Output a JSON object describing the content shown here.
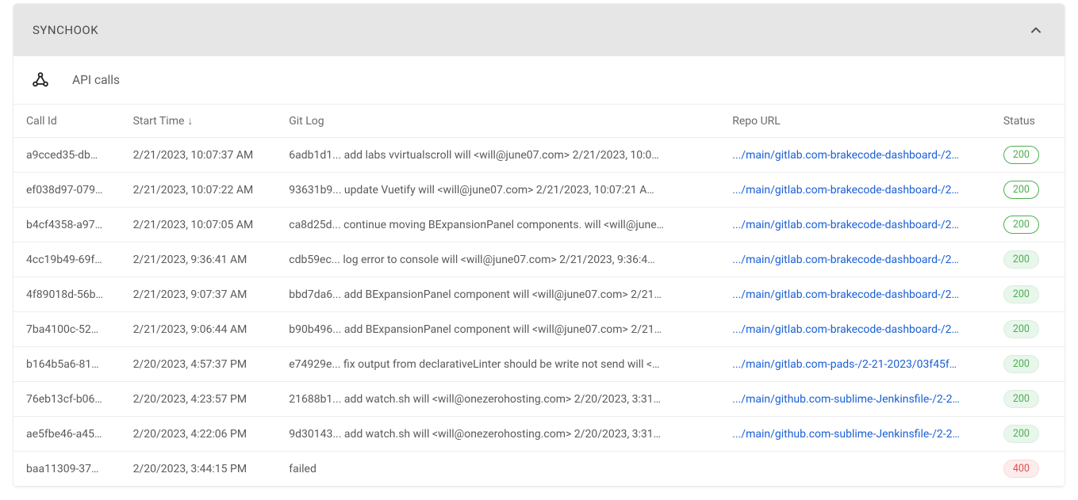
{
  "panel": {
    "title": "SYNCHOOK",
    "section_name": "API calls"
  },
  "table": {
    "headers": {
      "call_id": "Call Id",
      "start_time": "Start Time",
      "git_log": "Git Log",
      "repo_url": "Repo URL",
      "status": "Status"
    },
    "sort_indicator": "↓",
    "rows": [
      {
        "call_id": "a9cced35-db…",
        "start_time": "2/21/2023, 10:07:37 AM",
        "git_log": "6adb1d1...  add labs vvirtualscroll  will <will@june07.com>  2/21/2023, 10:0…",
        "repo_url": ".../main/gitlab.com-brakecode-dashboard-/2…",
        "status": "200",
        "status_style": "green-outline"
      },
      {
        "call_id": "ef038d97-079…",
        "start_time": "2/21/2023, 10:07:22 AM",
        "git_log": "93631b9...  update Vuetify  will <will@june07.com>  2/21/2023, 10:07:21 A…",
        "repo_url": ".../main/gitlab.com-brakecode-dashboard-/2…",
        "status": "200",
        "status_style": "green-outline"
      },
      {
        "call_id": "b4cf4358-a97…",
        "start_time": "2/21/2023, 10:07:05 AM",
        "git_log": "ca8d25d...  continue moving BExpansionPanel components.  will <will@june…",
        "repo_url": ".../main/gitlab.com-brakecode-dashboard-/2…",
        "status": "200",
        "status_style": "green-outline"
      },
      {
        "call_id": "4cc19b49-69f…",
        "start_time": "2/21/2023, 9:36:41 AM",
        "git_log": "cdb59ec...  log error to console  will <will@june07.com>  2/21/2023, 9:36:4…",
        "repo_url": ".../main/gitlab.com-brakecode-dashboard-/2…",
        "status": "200",
        "status_style": "green-fill"
      },
      {
        "call_id": "4f89018d-56b…",
        "start_time": "2/21/2023, 9:07:37 AM",
        "git_log": "bbd7da6...  add BExpansionPanel component  will <will@june07.com>  2/21…",
        "repo_url": ".../main/gitlab.com-brakecode-dashboard-/2…",
        "status": "200",
        "status_style": "green-fill"
      },
      {
        "call_id": "7ba4100c-52…",
        "start_time": "2/21/2023, 9:06:44 AM",
        "git_log": "b90b496...  add BExpansionPanel component  will <will@june07.com>  2/21…",
        "repo_url": ".../main/gitlab.com-brakecode-dashboard-/2…",
        "status": "200",
        "status_style": "green-fill"
      },
      {
        "call_id": "b164b5a6-81…",
        "start_time": "2/20/2023, 4:57:37 PM",
        "git_log": "e74929e...  fix output from declarativeLinter should be write not send  will <…",
        "repo_url": ".../main/gitlab.com-pads-/2-21-2023/03f45f…",
        "status": "200",
        "status_style": "green-fill"
      },
      {
        "call_id": "76eb13cf-b06…",
        "start_time": "2/20/2023, 4:23:57 PM",
        "git_log": "21688b1...  add watch.sh  will <will@onezerohosting.com>  2/20/2023, 3:31…",
        "repo_url": ".../main/github.com-sublime-Jenkinsfile-/2-2…",
        "status": "200",
        "status_style": "green-fill"
      },
      {
        "call_id": "ae5fbe46-a45…",
        "start_time": "2/20/2023, 4:22:06 PM",
        "git_log": "9d30143...  add watch.sh  will <will@onezerohosting.com>  2/20/2023, 3:31…",
        "repo_url": ".../main/github.com-sublime-Jenkinsfile-/2-2…",
        "status": "200",
        "status_style": "green-fill"
      },
      {
        "call_id": "baa11309-37…",
        "start_time": "2/20/2023, 3:44:15 PM",
        "git_log": "failed",
        "repo_url": "",
        "status": "400",
        "status_style": "red-fill"
      }
    ]
  }
}
